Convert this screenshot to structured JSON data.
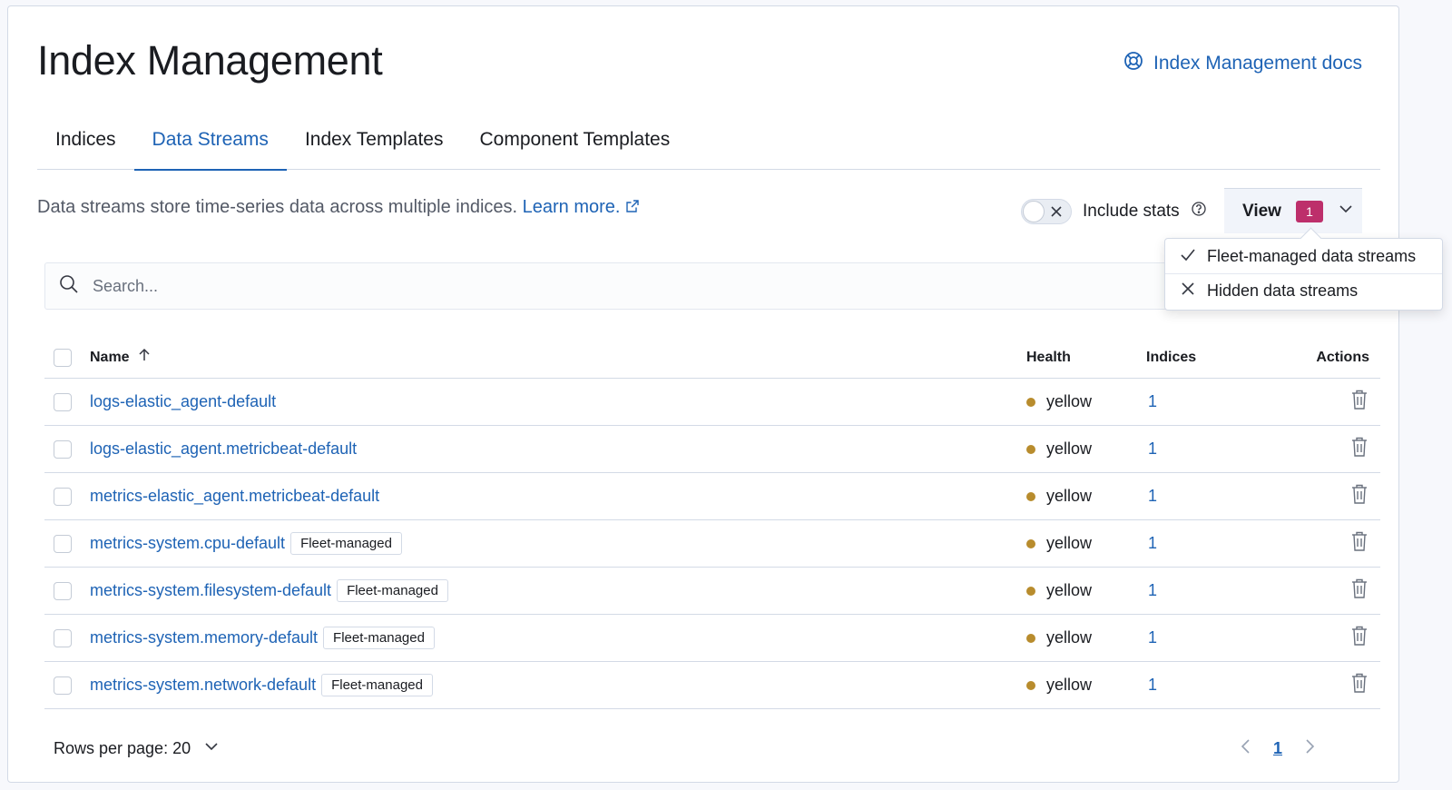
{
  "page": {
    "title": "Index Management",
    "docs_link": "Index Management docs"
  },
  "tabs": [
    {
      "label": "Indices",
      "active": false
    },
    {
      "label": "Data Streams",
      "active": true
    },
    {
      "label": "Index Templates",
      "active": false
    },
    {
      "label": "Component Templates",
      "active": false
    }
  ],
  "description": {
    "text": "Data streams store time-series data across multiple indices.",
    "link": "Learn more."
  },
  "toolbar": {
    "include_stats_label": "Include stats",
    "include_stats_on": false,
    "view_label": "View",
    "view_badge": "1"
  },
  "view_menu": [
    {
      "label": "Fleet-managed data streams",
      "checked": true
    },
    {
      "label": "Hidden data streams",
      "checked": false
    }
  ],
  "search": {
    "placeholder": "Search..."
  },
  "table": {
    "headers": {
      "name": "Name",
      "health": "Health",
      "indices": "Indices",
      "actions": "Actions"
    },
    "rows": [
      {
        "name": "logs-elastic_agent-default",
        "tag": "",
        "health": "yellow",
        "indices": "1"
      },
      {
        "name": "logs-elastic_agent.metricbeat-default",
        "tag": "",
        "health": "yellow",
        "indices": "1"
      },
      {
        "name": "metrics-elastic_agent.metricbeat-default",
        "tag": "",
        "health": "yellow",
        "indices": "1"
      },
      {
        "name": "metrics-system.cpu-default",
        "tag": "Fleet-managed",
        "health": "yellow",
        "indices": "1"
      },
      {
        "name": "metrics-system.filesystem-default",
        "tag": "Fleet-managed",
        "health": "yellow",
        "indices": "1"
      },
      {
        "name": "metrics-system.memory-default",
        "tag": "Fleet-managed",
        "health": "yellow",
        "indices": "1"
      },
      {
        "name": "metrics-system.network-default",
        "tag": "Fleet-managed",
        "health": "yellow",
        "indices": "1"
      }
    ]
  },
  "pagination": {
    "rows_per_page_label": "Rows per page: 20",
    "current_page": "1"
  },
  "colors": {
    "link": "#1e63b5",
    "health_yellow": "#b88c2d",
    "badge": "#bd2f6b"
  },
  "icons": {
    "docs": "help-buoy-icon",
    "external": "external-link-icon",
    "toggle_off": "cross-icon",
    "help": "question-icon",
    "dropdown": "chevron-down-icon",
    "search": "search-icon",
    "sort": "arrow-up-icon",
    "delete": "trash-icon",
    "prev": "chevron-left-icon",
    "next": "chevron-right-icon",
    "check": "check-icon",
    "cross": "cross-icon"
  }
}
